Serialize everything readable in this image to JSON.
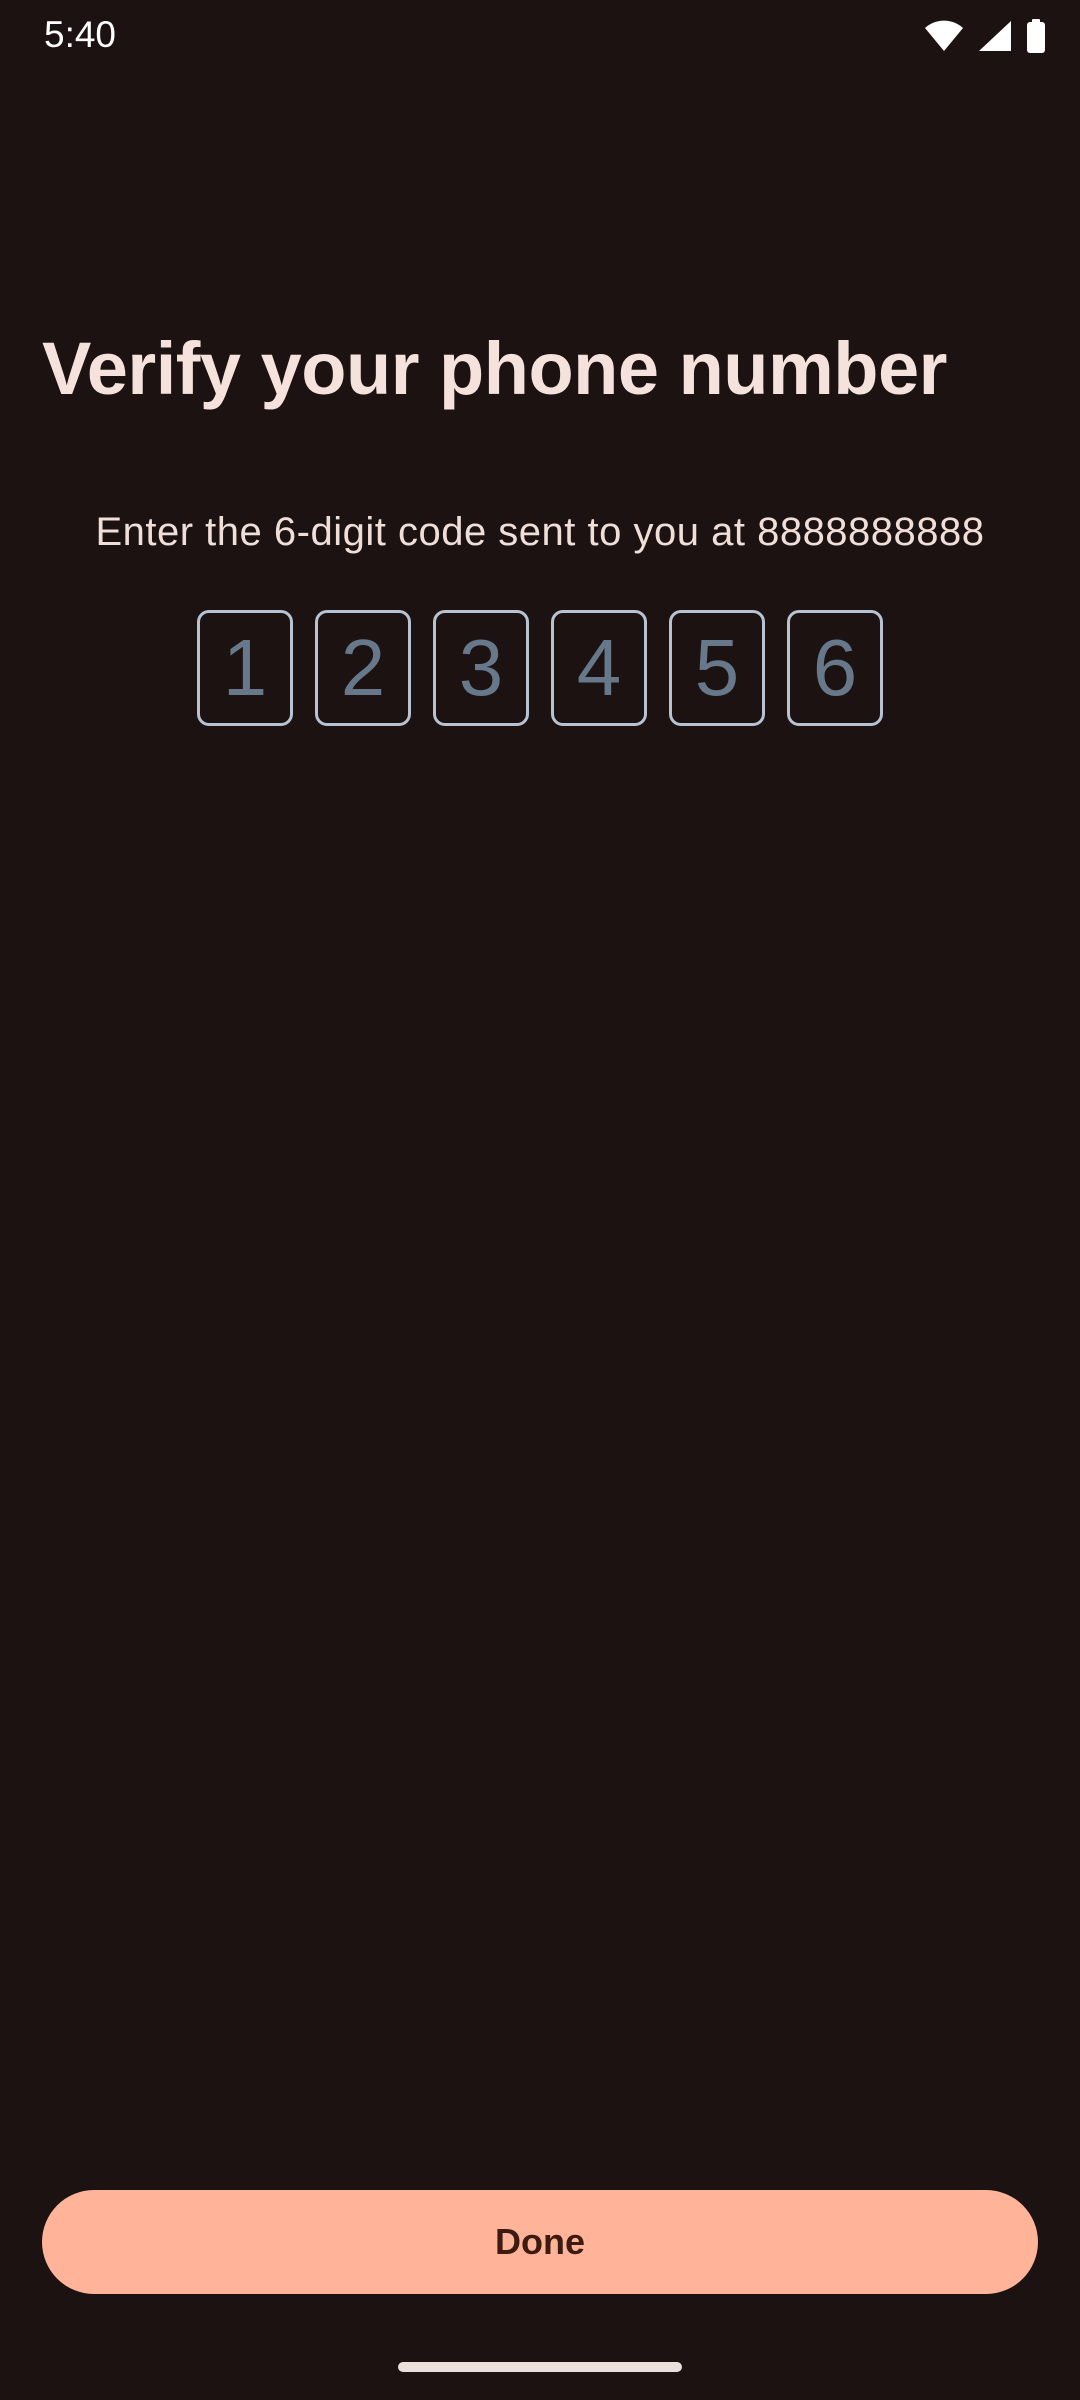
{
  "status_bar": {
    "time": "5:40",
    "icons": [
      "wifi-icon",
      "cell-signal-icon",
      "battery-icon"
    ]
  },
  "page": {
    "title": "Verify your phone number",
    "instruction": "Enter the 6-digit code sent to you at 8888888888"
  },
  "code_inputs": {
    "digits": [
      "1",
      "2",
      "3",
      "4",
      "5",
      "6"
    ]
  },
  "actions": {
    "done_label": "Done"
  },
  "colors": {
    "background": "#1b1211",
    "title_text": "#f5e2dc",
    "code_border": "#b7c3d2",
    "code_digit": "#66788a",
    "button_bg": "#ffb49a",
    "button_text": "#3d1b10"
  }
}
